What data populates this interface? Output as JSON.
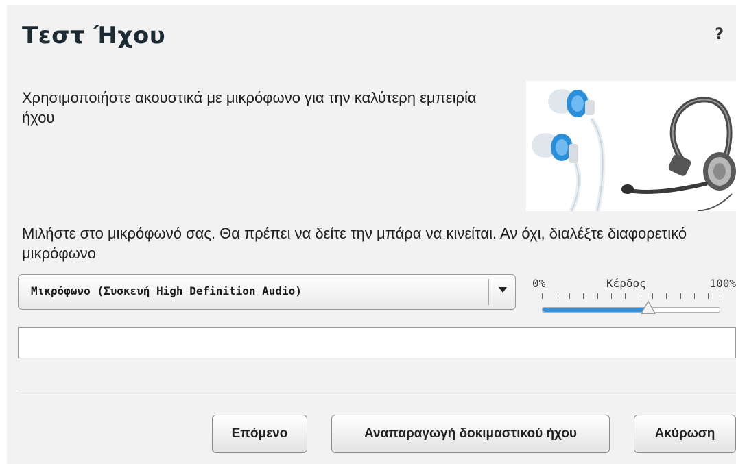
{
  "dialog": {
    "title": "Τεστ Ήχου",
    "help": "?"
  },
  "intro_text": "Χρησιμοποιήστε ακουστικά με μικρόφωνο για την καλύτερη εμπειρία ήχου",
  "illustration": {
    "icons": [
      "earbuds-icon",
      "headset-icon"
    ],
    "colors": {
      "earbud_accent": "#2a8fd8",
      "headset_body": "#4a4a4a"
    }
  },
  "instruction_text": "Μιλήστε στο μικρόφωνό σας. Θα πρέπει να δείτε την μπάρα να κινείται. Αν όχι, διαλέξτε διαφορετικό μικρόφωνο",
  "microphone_select": {
    "selected": "Μικρόφωνο (Συσκευή High Definition Audio)"
  },
  "gain": {
    "min_label": "0%",
    "label": "Κέρδος",
    "max_label": "100%",
    "value_percent": 60
  },
  "input_level_percent": 0,
  "buttons": {
    "next": "Επόμενο",
    "play_test_sound": "Αναπαραγωγή δοκιμαστικού ήχου",
    "cancel": "Ακύρωση"
  },
  "colors": {
    "accent": "#3a8fd6",
    "panel_bg": "#f2f2f2",
    "title": "#1c2b33"
  }
}
